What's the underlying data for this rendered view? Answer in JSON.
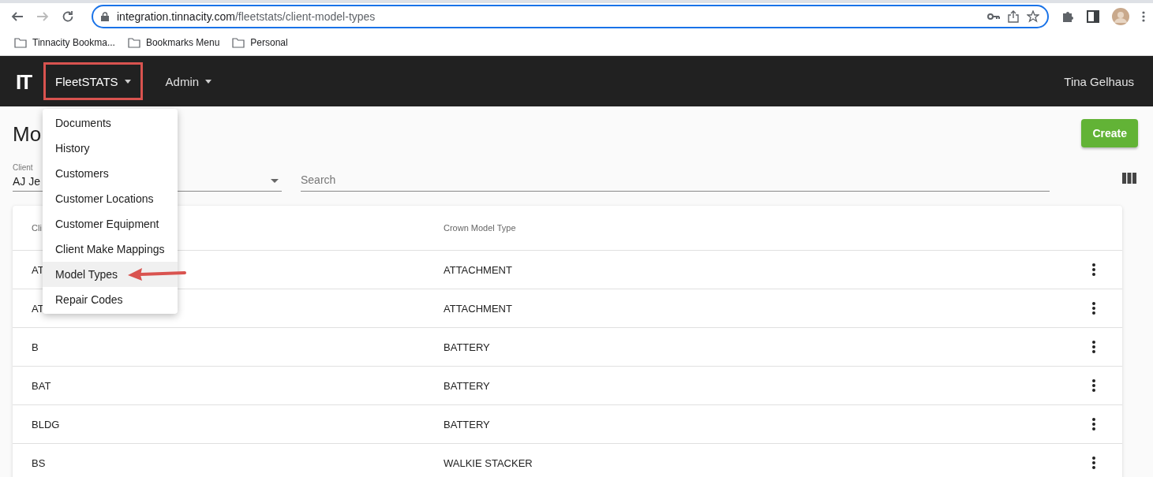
{
  "browser": {
    "url_host": "integration.tinnacity.com",
    "url_path": "/fleetstats/client-model-types",
    "bookmarks": [
      {
        "label": "Tinnacity Bookma..."
      },
      {
        "label": "Bookmarks Menu"
      },
      {
        "label": "Personal"
      }
    ]
  },
  "navbar": {
    "logo": "IT",
    "menus": [
      {
        "label": "FleetSTATS",
        "open": true,
        "annotated": true
      },
      {
        "label": "Admin",
        "open": false,
        "annotated": false
      }
    ],
    "user": "Tina Gelhaus"
  },
  "dropdown": {
    "items": [
      {
        "label": "Documents",
        "selected": false,
        "pointed": false
      },
      {
        "label": "History",
        "selected": false,
        "pointed": false
      },
      {
        "label": "Customers",
        "selected": false,
        "pointed": false
      },
      {
        "label": "Customer Locations",
        "selected": false,
        "pointed": false
      },
      {
        "label": "Customer Equipment",
        "selected": false,
        "pointed": false
      },
      {
        "label": "Client Make Mappings",
        "selected": false,
        "pointed": false
      },
      {
        "label": "Model Types",
        "selected": true,
        "pointed": true
      },
      {
        "label": "Repair Codes",
        "selected": false,
        "pointed": false
      }
    ]
  },
  "page": {
    "title": "Mo",
    "create_button": "Create",
    "client_field": {
      "label": "Client",
      "value": "AJ Je"
    },
    "search": {
      "placeholder": "Search"
    }
  },
  "table": {
    "columns": [
      "Cli",
      "Crown Model Type"
    ],
    "rows": [
      {
        "cells": [
          "AT",
          "ATTACHMENT"
        ]
      },
      {
        "cells": [
          "AT",
          "ATTACHMENT"
        ]
      },
      {
        "cells": [
          "B",
          "BATTERY"
        ]
      },
      {
        "cells": [
          "BAT",
          "BATTERY"
        ]
      },
      {
        "cells": [
          "BLDG",
          "BATTERY"
        ]
      },
      {
        "cells": [
          "BS",
          "WALKIE STACKER"
        ]
      }
    ]
  }
}
